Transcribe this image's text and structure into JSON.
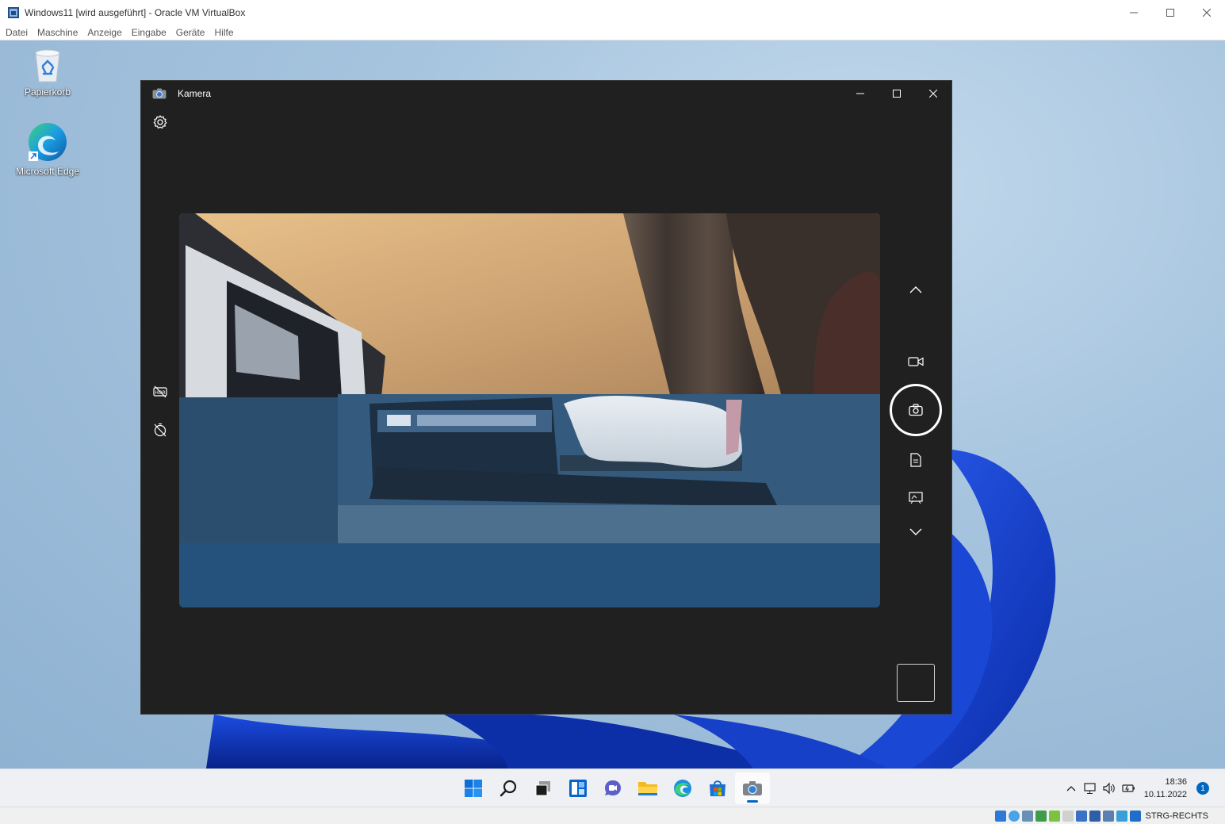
{
  "host": {
    "title": "Windows11 [wird ausgeführt] - Oracle VM VirtualBox",
    "menu": [
      "Datei",
      "Maschine",
      "Anzeige",
      "Eingabe",
      "Geräte",
      "Hilfe"
    ],
    "host_key": "STRG-RECHTS"
  },
  "desktop": {
    "icons": [
      {
        "label": "Papierkorb",
        "icon": "recycle-bin-icon"
      },
      {
        "label": "Microsoft Edge",
        "icon": "edge-icon"
      }
    ]
  },
  "camera_app": {
    "title": "Kamera",
    "modes": [
      "video",
      "photo",
      "document",
      "whiteboard"
    ],
    "active_mode": "photo",
    "left_tools": [
      "hdr-off-icon",
      "timer-off-icon"
    ]
  },
  "taskbar": {
    "apps": [
      "start-icon",
      "search-icon",
      "task-view-icon",
      "widgets-icon",
      "chat-icon",
      "file-explorer-icon",
      "edge-icon",
      "store-icon",
      "camera-icon"
    ],
    "active_app": "camera-icon",
    "time": "18:36",
    "date": "10.11.2022",
    "notification_count": "1"
  },
  "colors": {
    "accent": "#0067c0",
    "camera_bg": "#202020",
    "preview_blue": "#25527d"
  }
}
